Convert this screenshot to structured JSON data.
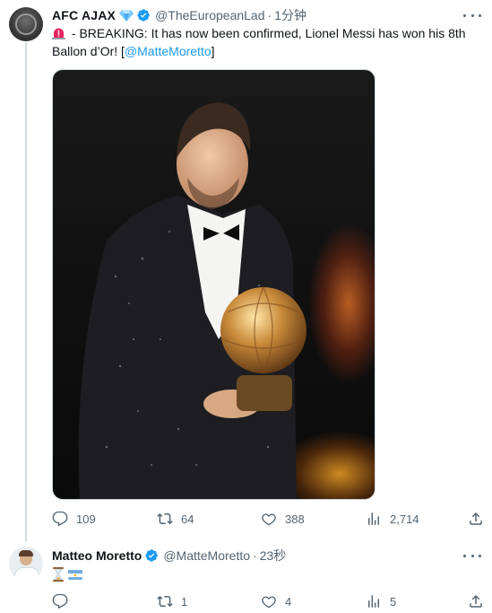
{
  "tweet": {
    "author_name": "AFC AJAX",
    "author_handle": "@TheEuropeanLad",
    "separator": "·",
    "time": "1分钟",
    "text_prefix": " - BREAKING: It has now been confirmed, Lionel Messi has won his 8th Ballon d’Or! [",
    "mention": "@MatteMoretto",
    "text_suffix": "]",
    "stats": {
      "replies": "109",
      "retweets": "64",
      "likes": "388",
      "views": "2,714"
    }
  },
  "reply": {
    "author_name": "Matteo Moretto",
    "author_handle": "@MatteMoretto",
    "separator": "·",
    "time": "23秒",
    "stats": {
      "replies": "",
      "retweets": "1",
      "likes": "4",
      "views": "5"
    }
  },
  "icons": {
    "verified": "verified-badge-icon",
    "diamond": "blue-diamond-icon",
    "siren": "rotating-light-icon",
    "hourglass": "hourglass-icon",
    "flag": "argentina-flag-icon"
  },
  "colors": {
    "accent": "#1d9bf0",
    "text": "#0f1419",
    "muted": "#536471",
    "border": "#cfd9de"
  }
}
